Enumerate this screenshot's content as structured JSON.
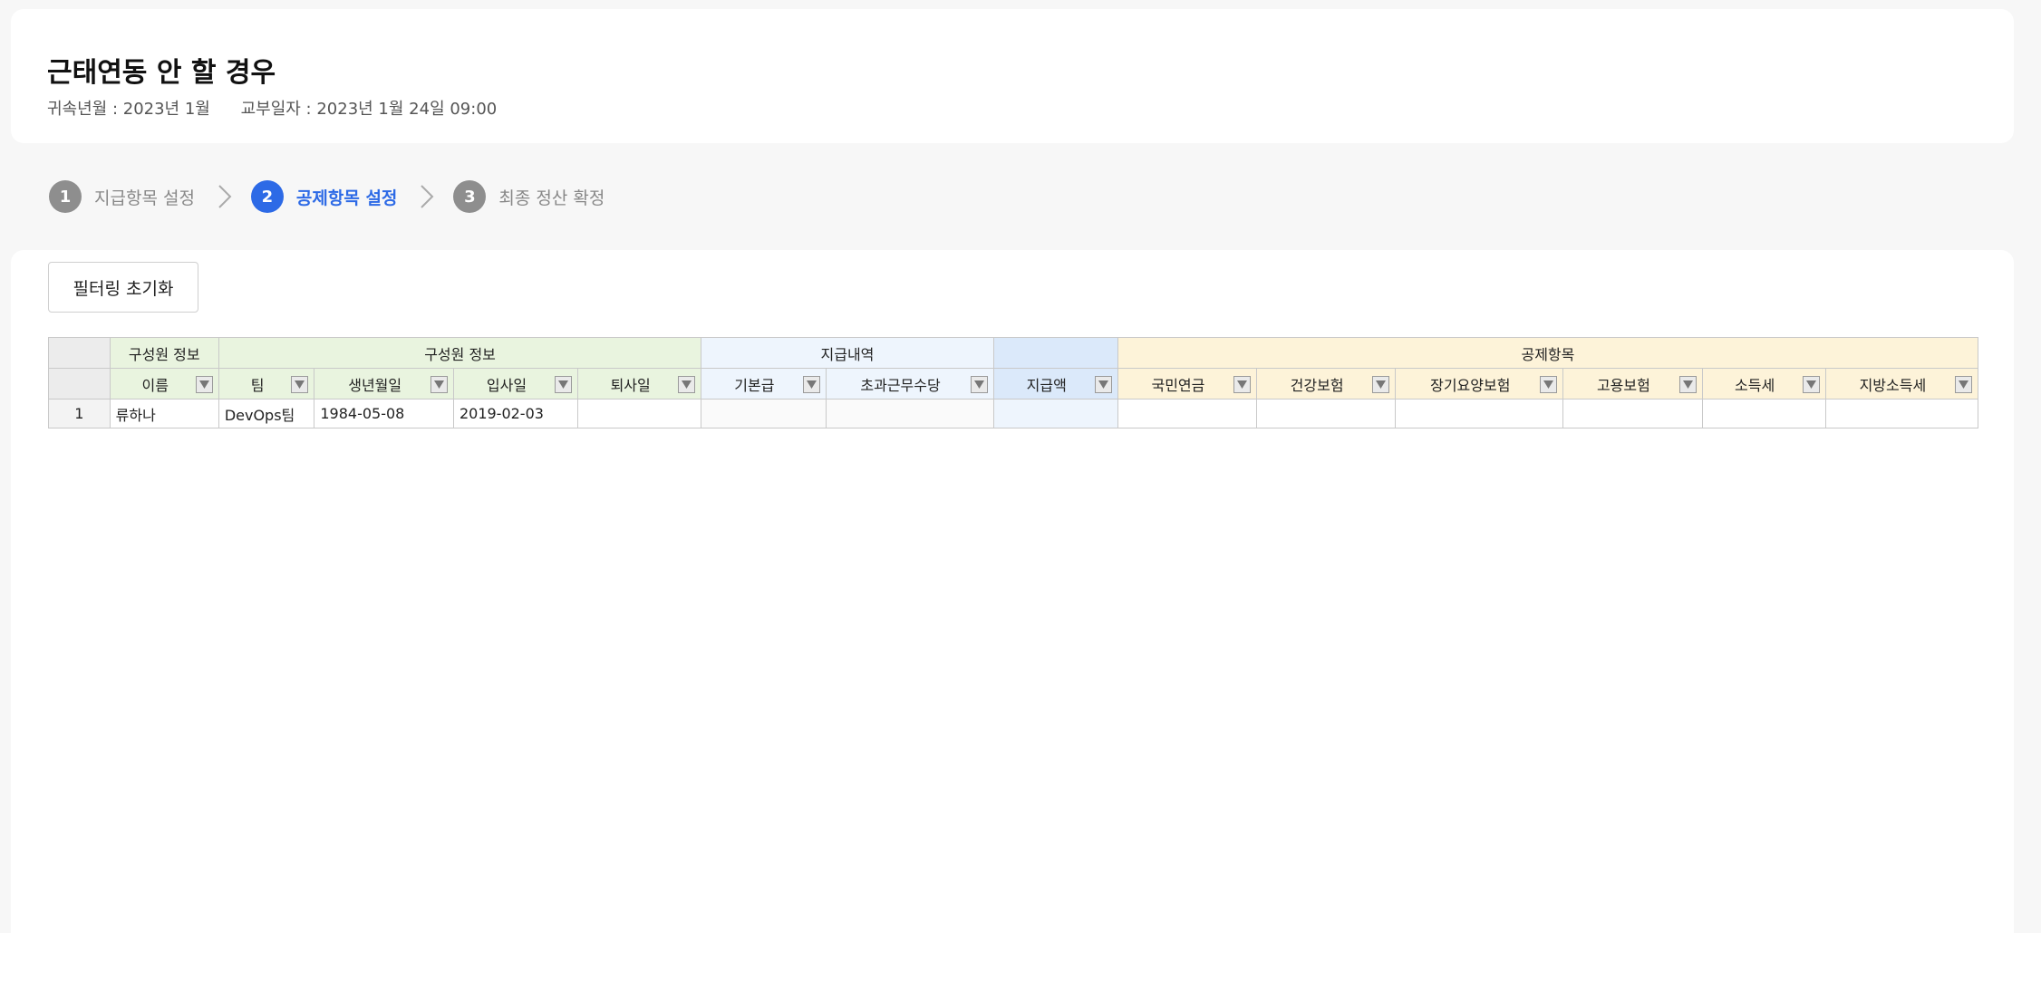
{
  "header": {
    "title": "근태연동 안 할 경우",
    "period": "귀속년월 : 2023년 1월",
    "issue_date": "교부일자 : 2023년 1월 24일 09:00"
  },
  "steps": [
    {
      "num": "1",
      "label": "지급항목 설정",
      "active": false
    },
    {
      "num": "2",
      "label": "공제항목 설정",
      "active": true
    },
    {
      "num": "3",
      "label": "최종 정산 확정",
      "active": false
    }
  ],
  "toolbar": {
    "reset_label": "필터링 초기화"
  },
  "grid": {
    "groups": {
      "member_a": "구성원 정보",
      "member_b": "구성원 정보",
      "pay": "지급내역",
      "deduct": "공제항목"
    },
    "columns": {
      "name": "이름",
      "team": "팀",
      "birth": "생년월일",
      "join": "입사일",
      "leave": "퇴사일",
      "base": "기본급",
      "overtime": "초과근무수당",
      "total": "지급액",
      "pension": "국민연금",
      "health": "건강보험",
      "longterm": "장기요양보험",
      "employment": "고용보험",
      "income_tax": "소득세",
      "local_tax": "지방소득세"
    },
    "rows": [
      {
        "index": "1",
        "name": "류하나",
        "team": "DevOps팀",
        "birth": "1984-05-08",
        "join": "2019-02-03",
        "leave": "",
        "base": "",
        "overtime": "",
        "total": "",
        "pension": "",
        "health": "",
        "longterm": "",
        "employment": "",
        "income_tax": "",
        "local_tax": ""
      }
    ]
  },
  "colors": {
    "accent": "#2d6ae6",
    "step_inactive": "#8e8e8e",
    "member_group": "#e9f4df",
    "pay_group": "#eef5fd",
    "total_group": "#dbe9fa",
    "deduct_group": "#fdf3d9"
  }
}
